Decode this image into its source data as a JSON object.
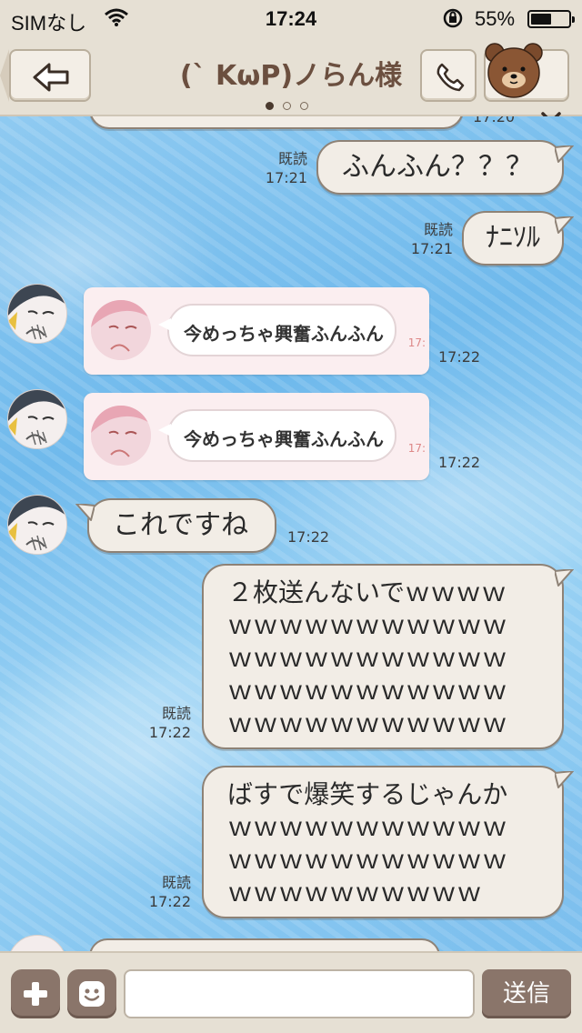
{
  "status_bar": {
    "carrier": "SIMなし",
    "time": "17:24",
    "battery_percent": "55%",
    "battery_level": 0.55,
    "icons": [
      "wifi-icon",
      "rotation-lock-icon",
      "battery-icon"
    ]
  },
  "header": {
    "title": "(` KωP)ノらん様",
    "page_indicator": {
      "count": 3,
      "active": 1
    },
    "icons": [
      "back-arrow-icon",
      "phone-icon",
      "bear-icon",
      "chevron-down-icon"
    ]
  },
  "messages": [
    {
      "id": "m0",
      "direction": "incoming",
      "partial": true,
      "text": "",
      "time": "17:20"
    },
    {
      "id": "m1",
      "direction": "outgoing",
      "text": "ふんふん？？？",
      "read": "既読",
      "time": "17:21"
    },
    {
      "id": "m2",
      "direction": "outgoing",
      "text": "ﾅﾆｿﾙ",
      "read": "既読",
      "time": "17:21"
    },
    {
      "id": "m3",
      "direction": "incoming",
      "type": "sticker",
      "sticker_text": "今めっちゃ興奮ふんふん",
      "time": "17:22"
    },
    {
      "id": "m4",
      "direction": "incoming",
      "type": "sticker",
      "sticker_text": "今めっちゃ興奮ふんふん",
      "time": "17:22"
    },
    {
      "id": "m5",
      "direction": "incoming",
      "text": "これですね",
      "time": "17:22"
    },
    {
      "id": "m6",
      "direction": "outgoing",
      "lines": [
        "２枚送んないでｗｗｗｗ",
        "ｗｗｗｗｗｗｗｗｗｗｗ",
        "ｗｗｗｗｗｗｗｗｗｗｗ",
        "ｗｗｗｗｗｗｗｗｗｗｗ",
        "ｗｗｗｗｗｗｗｗｗｗｗ"
      ],
      "read": "既読",
      "time": "17:22"
    },
    {
      "id": "m7",
      "direction": "outgoing",
      "lines": [
        "ばすで爆笑するじゃんか",
        "ｗｗｗｗｗｗｗｗｗｗｗ",
        "ｗｗｗｗｗｗｗｗｗｗｗ",
        "ｗｗｗｗｗｗｗｗｗｗ"
      ],
      "read": "既読",
      "time": "17:22"
    }
  ],
  "input_bar": {
    "input_value": "",
    "send_label": "送信",
    "icons": [
      "plus-icon",
      "emoji-icon"
    ]
  }
}
